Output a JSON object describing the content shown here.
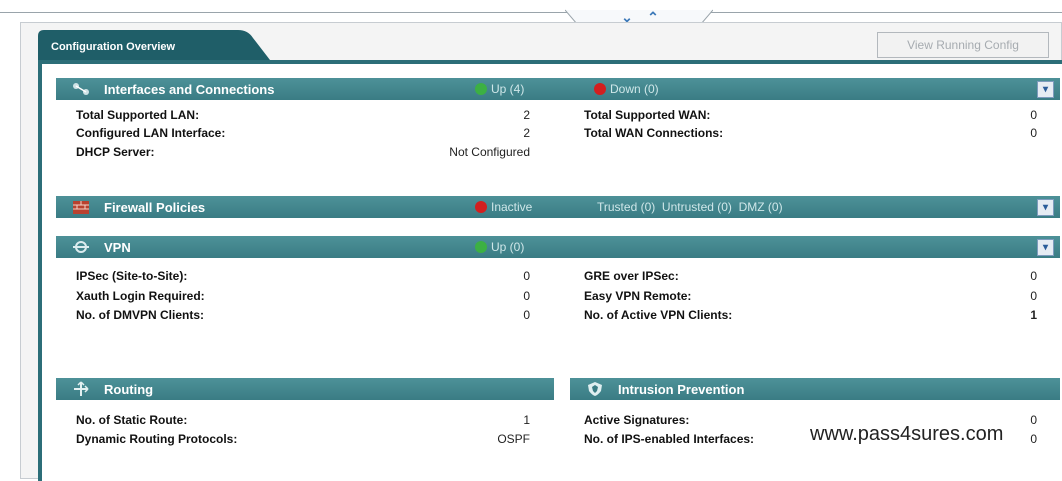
{
  "toolbar": {
    "collapse_glyph": "⌄",
    "expand_glyph": "⌃"
  },
  "tab": {
    "label": "Configuration Overview"
  },
  "view_button": {
    "label": "View Running Config"
  },
  "interfaces": {
    "title": "Interfaces and Connections",
    "up": "Up (4)",
    "down": "Down (0)",
    "rows": [
      {
        "label": "Total Supported LAN:",
        "value": "2"
      },
      {
        "label": "Configured LAN Interface:",
        "value": "2"
      },
      {
        "label": "DHCP Server:",
        "value": "Not Configured"
      }
    ],
    "rows_right": [
      {
        "label": "Total Supported WAN:",
        "value": "0"
      },
      {
        "label": "Total WAN Connections:",
        "value": "0"
      }
    ]
  },
  "firewall": {
    "title": "Firewall Policies",
    "status": "Inactive",
    "zones": "Trusted (0)  Untrusted (0)  DMZ (0)"
  },
  "vpn": {
    "title": "VPN",
    "up": "Up (0)",
    "rows": [
      {
        "label": "IPSec (Site-to-Site):",
        "value": "0"
      },
      {
        "label": "Xauth Login Required:",
        "value": "0"
      },
      {
        "label": "No. of DMVPN Clients:",
        "value": "0"
      }
    ],
    "rows_right": [
      {
        "label": "GRE over IPSec:",
        "value": "0"
      },
      {
        "label": "Easy VPN Remote:",
        "value": "0"
      },
      {
        "label": "No. of Active VPN Clients:",
        "value": "1"
      }
    ]
  },
  "routing": {
    "title": "Routing",
    "rows": [
      {
        "label": "No. of Static Route:",
        "value": "1"
      },
      {
        "label": "Dynamic Routing Protocols:",
        "value": "OSPF"
      }
    ]
  },
  "ips": {
    "title": "Intrusion Prevention",
    "rows": [
      {
        "label": "Active Signatures:",
        "value": "0"
      },
      {
        "label": "No. of IPS-enabled Interfaces:",
        "value": "0"
      }
    ]
  },
  "watermark": "www.pass4sures.com",
  "colors": {
    "section_bar": "#3f8289",
    "tab": "#1f5e68",
    "up": "#3cb043",
    "down": "#d21f1f"
  }
}
